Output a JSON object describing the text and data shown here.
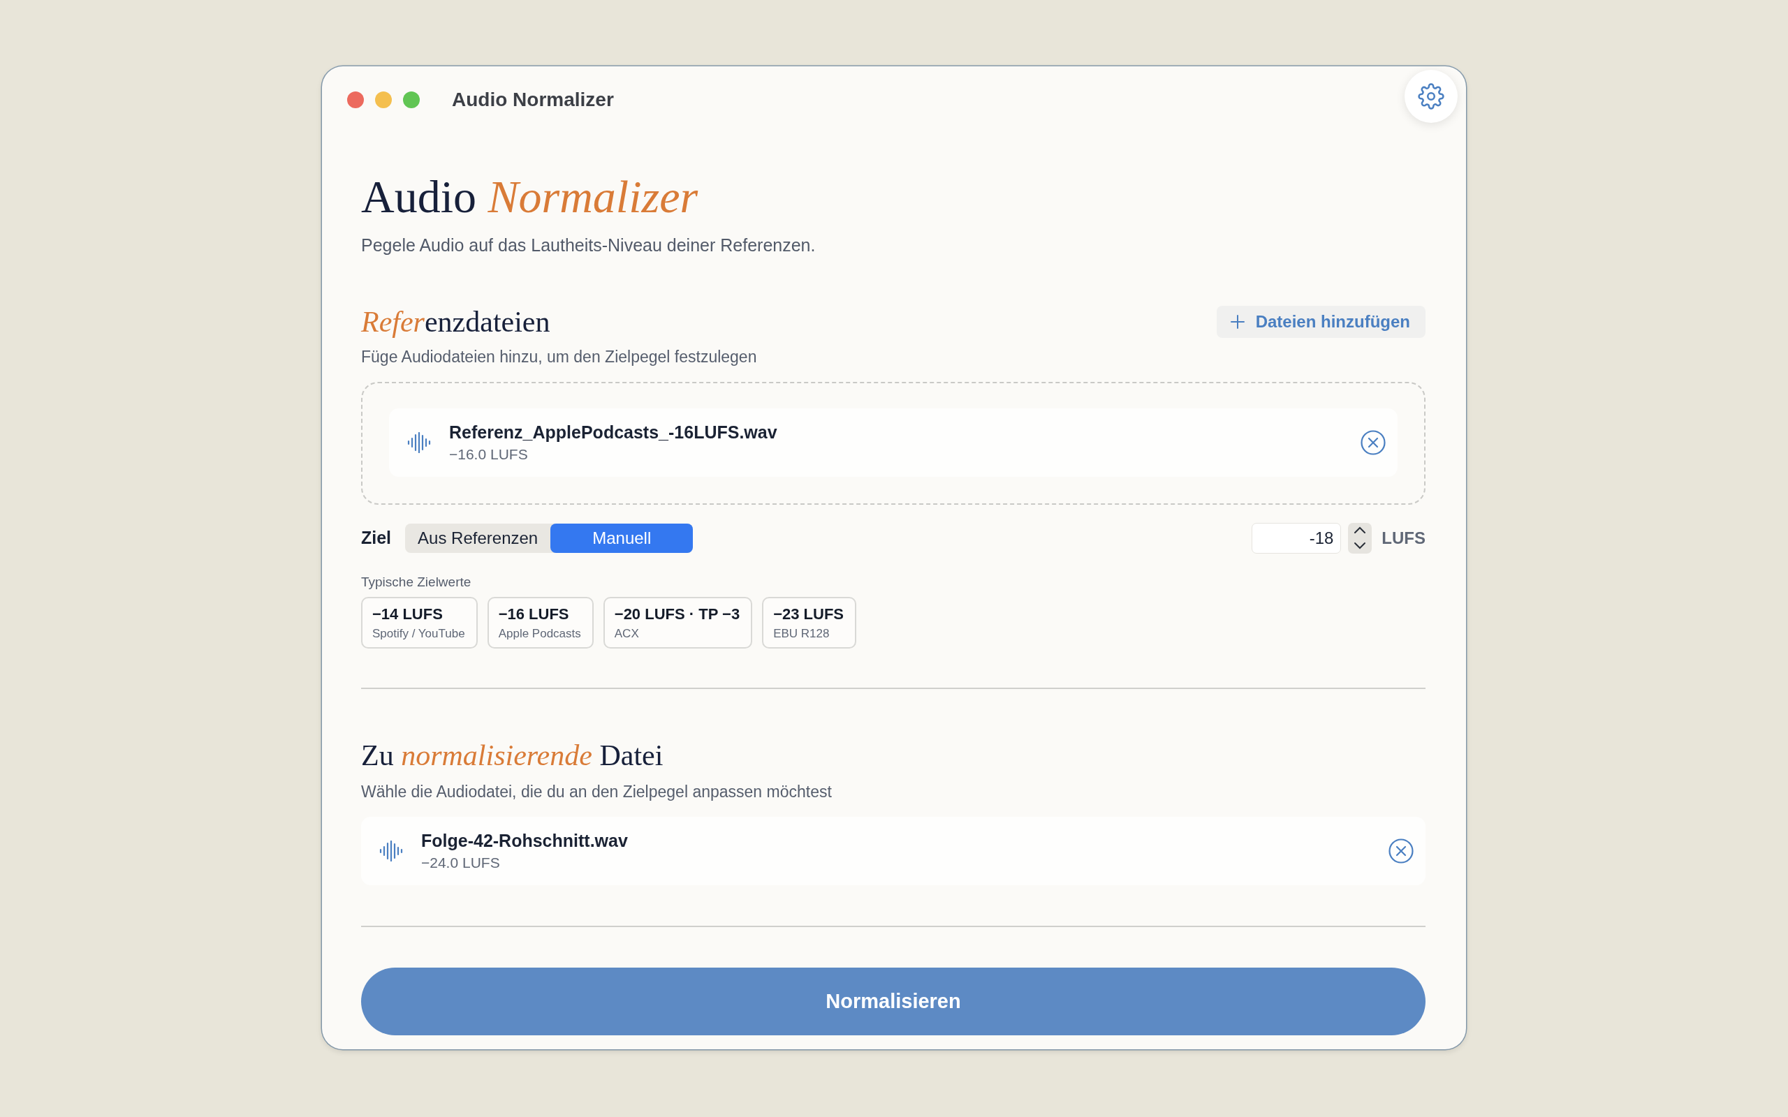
{
  "window": {
    "title": "Audio Normalizer"
  },
  "header": {
    "title": [
      {
        "text": "Audio ",
        "accent": false
      },
      {
        "text": "Normalizer",
        "accent": true
      }
    ],
    "subtitle": "Pegele Audio auf das Lautheits-Niveau deiner Referenzen."
  },
  "reference": {
    "title": [
      {
        "text": "Refer",
        "accent": true
      },
      {
        "text": "enzdateien",
        "accent": false
      }
    ],
    "add_button": "Dateien hinzufügen",
    "description": "Füge Audiodateien hinzu, um den Zielpegel festzulegen",
    "files": [
      {
        "name": "Referenz_ApplePodcasts_-16LUFS.wav",
        "loudness": "−16.0 LUFS"
      }
    ]
  },
  "target": {
    "label": "Ziel",
    "modes": [
      {
        "label": "Aus Referenzen",
        "selected": false
      },
      {
        "label": "Manuell",
        "selected": true
      }
    ],
    "value": "-18",
    "unit": "LUFS",
    "presets_label": "Typische Zielwerte",
    "presets": [
      {
        "value": "−14 LUFS",
        "platform": "Spotify / YouTube"
      },
      {
        "value": "−16 LUFS",
        "platform": "Apple Podcasts"
      },
      {
        "value": "−20 LUFS · TP −3",
        "platform": "ACX"
      },
      {
        "value": "−23 LUFS",
        "platform": "EBU R128"
      }
    ]
  },
  "input": {
    "title": [
      {
        "text": "Zu ",
        "accent": false
      },
      {
        "text": "normalisierende",
        "accent": true
      },
      {
        "text": " Datei",
        "accent": false
      }
    ],
    "description": "Wähle die Audiodatei, die du an den Zielpegel anpassen möchtest",
    "files": [
      {
        "name": "Folge-42-Rohschnitt.wav",
        "loudness": "−24.0 LUFS"
      }
    ]
  },
  "action_button": "Normalisieren"
}
